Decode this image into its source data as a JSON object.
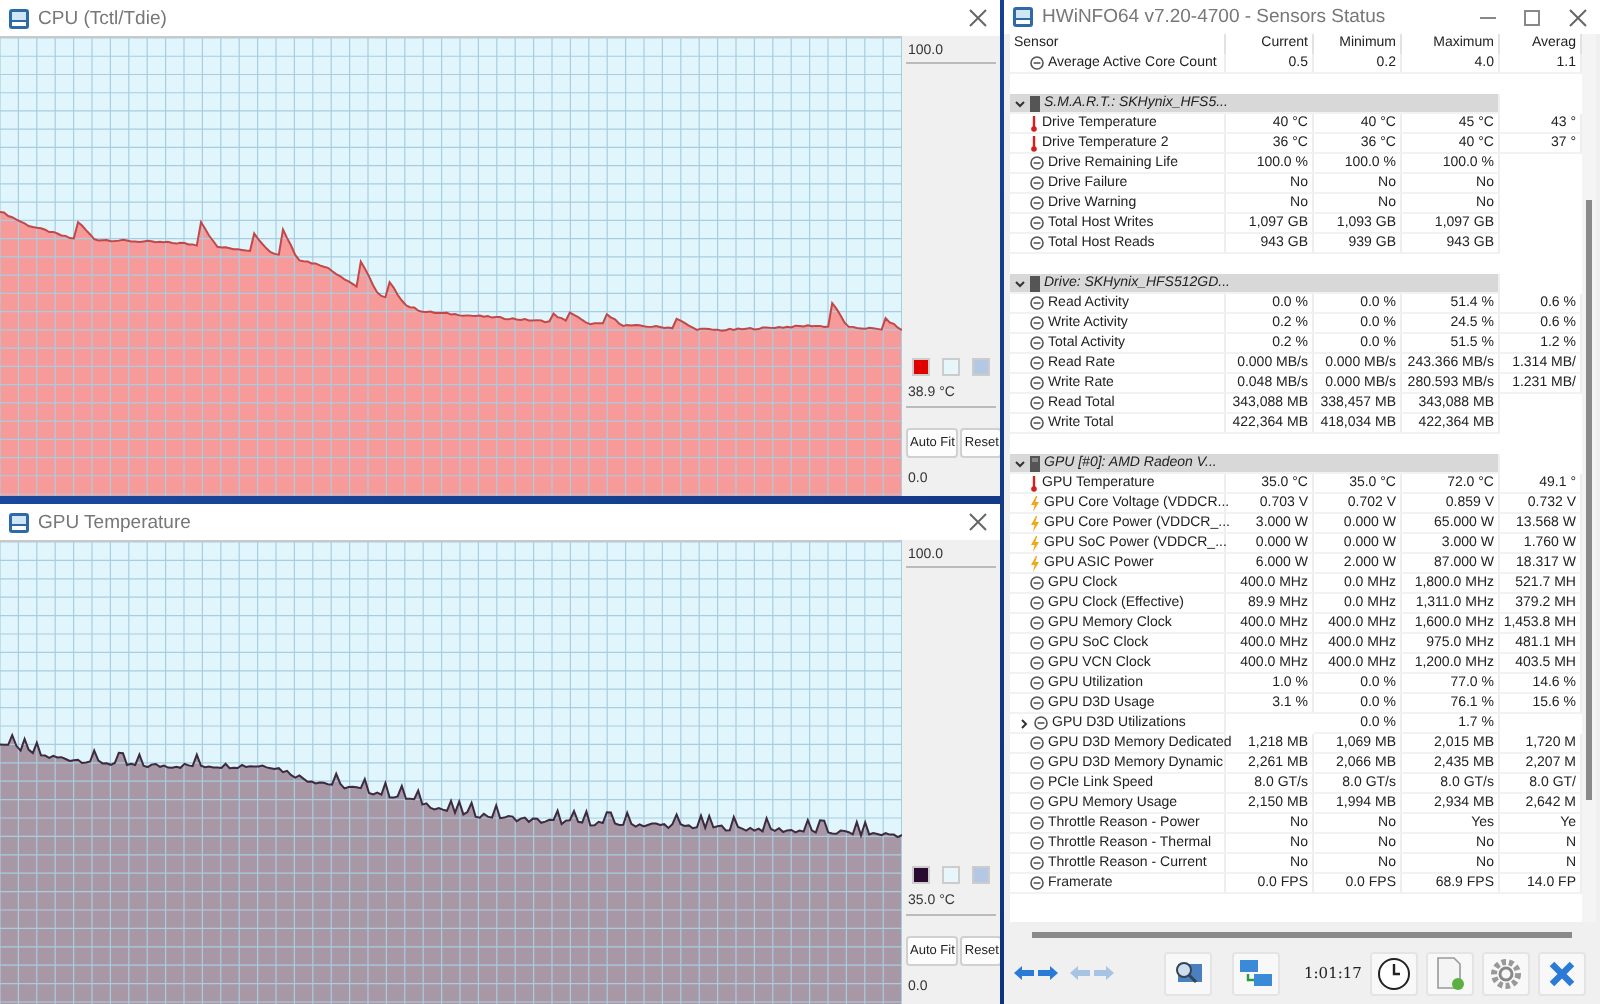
{
  "graph_windows": [
    {
      "title": "CPU (Tctl/Tdie)",
      "scale_max": "100.0",
      "scale_min": "0.0",
      "reading": "38.9 °C",
      "swatches": [
        {
          "color": "#e00000"
        },
        {
          "color": "#e6f6fb"
        },
        {
          "color": "#b4c8e4"
        }
      ],
      "buttons": [
        "Auto Fit",
        "Reset"
      ]
    },
    {
      "title": "GPU Temperature",
      "scale_max": "100.0",
      "scale_min": "0.0",
      "reading": "35.0 °C",
      "swatches": [
        {
          "color": "#2a0a30"
        },
        {
          "color": "#e6f6fb"
        },
        {
          "color": "#b4c8e4"
        }
      ],
      "buttons": [
        "Auto Fit",
        "Reset"
      ]
    }
  ],
  "sensors_window": {
    "title": "HWiNFO64 v7.20-4700 - Sensors Status",
    "columns": [
      "Sensor",
      "Current",
      "Minimum",
      "Maximum",
      "Averag"
    ],
    "top_rows": [
      {
        "kind": "gauge",
        "name": "Average Active Core Count",
        "current": "0.5",
        "minimum": "0.2",
        "maximum": "4.0",
        "average": "1.1"
      }
    ],
    "groups": [
      {
        "title": "S.M.A.R.T.: SKHynix_HFS5...",
        "kind": "drive",
        "expanded": true,
        "rows": [
          {
            "kind": "temperature",
            "name": "Drive Temperature",
            "current": "40 °C",
            "minimum": "40 °C",
            "maximum": "45 °C",
            "average": "43 °"
          },
          {
            "kind": "temperature",
            "name": "Drive Temperature 2",
            "current": "36 °C",
            "minimum": "36 °C",
            "maximum": "40 °C",
            "average": "37 °"
          },
          {
            "kind": "gauge",
            "name": "Drive Remaining Life",
            "current": "100.0 %",
            "minimum": "100.0 %",
            "maximum": "100.0 %"
          },
          {
            "kind": "gauge",
            "name": "Drive Failure",
            "current": "No",
            "minimum": "No",
            "maximum": "No"
          },
          {
            "kind": "gauge",
            "name": "Drive Warning",
            "current": "No",
            "minimum": "No",
            "maximum": "No"
          },
          {
            "kind": "gauge",
            "name": "Total Host Writes",
            "current": "1,097 GB",
            "minimum": "1,093 GB",
            "maximum": "1,097 GB"
          },
          {
            "kind": "gauge",
            "name": "Total Host Reads",
            "current": "943 GB",
            "minimum": "939 GB",
            "maximum": "943 GB"
          }
        ]
      },
      {
        "title": "Drive: SKHynix_HFS512GD...",
        "kind": "drive",
        "expanded": true,
        "rows": [
          {
            "kind": "gauge",
            "name": "Read Activity",
            "current": "0.0 %",
            "minimum": "0.0 %",
            "maximum": "51.4 %",
            "average": "0.6 %"
          },
          {
            "kind": "gauge",
            "name": "Write Activity",
            "current": "0.2 %",
            "minimum": "0.0 %",
            "maximum": "24.5 %",
            "average": "0.6 %"
          },
          {
            "kind": "gauge",
            "name": "Total Activity",
            "current": "0.2 %",
            "minimum": "0.0 %",
            "maximum": "51.5 %",
            "average": "1.2 %"
          },
          {
            "kind": "gauge",
            "name": "Read Rate",
            "current": "0.000 MB/s",
            "minimum": "0.000 MB/s",
            "maximum": "243.366 MB/s",
            "average": "1.314 MB/"
          },
          {
            "kind": "gauge",
            "name": "Write Rate",
            "current": "0.048 MB/s",
            "minimum": "0.000 MB/s",
            "maximum": "280.593 MB/s",
            "average": "1.231 MB/"
          },
          {
            "kind": "gauge",
            "name": "Read Total",
            "current": "343,088 MB",
            "minimum": "338,457 MB",
            "maximum": "343,088 MB"
          },
          {
            "kind": "gauge",
            "name": "Write Total",
            "current": "422,364 MB",
            "minimum": "418,034 MB",
            "maximum": "422,364 MB"
          }
        ]
      },
      {
        "title": "GPU [#0]: AMD Radeon V...",
        "kind": "card",
        "expanded": true,
        "rows": [
          {
            "kind": "temperature",
            "name": "GPU Temperature",
            "current": "35.0 °C",
            "minimum": "35.0 °C",
            "maximum": "72.0 °C",
            "average": "49.1 °"
          },
          {
            "kind": "power",
            "name": "GPU Core Voltage (VDDCR...",
            "current": "0.703 V",
            "minimum": "0.702 V",
            "maximum": "0.859 V",
            "average": "0.732 V"
          },
          {
            "kind": "power",
            "name": "GPU Core Power (VDDCR_...",
            "current": "3.000 W",
            "minimum": "0.000 W",
            "maximum": "65.000 W",
            "average": "13.568 W"
          },
          {
            "kind": "power",
            "name": "GPU SoC Power (VDDCR_...",
            "current": "0.000 W",
            "minimum": "0.000 W",
            "maximum": "3.000 W",
            "average": "1.760 W"
          },
          {
            "kind": "power",
            "name": "GPU ASIC Power",
            "current": "6.000 W",
            "minimum": "2.000 W",
            "maximum": "87.000 W",
            "average": "18.317 W"
          },
          {
            "kind": "gauge",
            "name": "GPU Clock",
            "current": "400.0 MHz",
            "minimum": "0.0 MHz",
            "maximum": "1,800.0 MHz",
            "average": "521.7 MH"
          },
          {
            "kind": "gauge",
            "name": "GPU Clock (Effective)",
            "current": "89.9 MHz",
            "minimum": "0.0 MHz",
            "maximum": "1,311.0 MHz",
            "average": "379.2 MH"
          },
          {
            "kind": "gauge",
            "name": "GPU Memory Clock",
            "current": "400.0 MHz",
            "minimum": "400.0 MHz",
            "maximum": "1,600.0 MHz",
            "average": "1,453.8 MH"
          },
          {
            "kind": "gauge",
            "name": "GPU SoC Clock",
            "current": "400.0 MHz",
            "minimum": "400.0 MHz",
            "maximum": "975.0 MHz",
            "average": "481.1 MH"
          },
          {
            "kind": "gauge",
            "name": "GPU VCN Clock",
            "current": "400.0 MHz",
            "minimum": "400.0 MHz",
            "maximum": "1,200.0 MHz",
            "average": "403.5 MH"
          },
          {
            "kind": "gauge",
            "name": "GPU Utilization",
            "current": "1.0 %",
            "minimum": "0.0 %",
            "maximum": "77.0 %",
            "average": "14.6 %"
          },
          {
            "kind": "gauge",
            "name": "GPU D3D Usage",
            "current": "3.1 %",
            "minimum": "0.0 %",
            "maximum": "76.1 %",
            "average": "15.6 %"
          },
          {
            "kind": "gauge",
            "name": "GPU D3D Utilizations",
            "expanded": false,
            "minimum": "0.0 %",
            "maximum": "1.7 %"
          },
          {
            "kind": "gauge",
            "name": "GPU D3D Memory Dedicated",
            "current": "1,218 MB",
            "minimum": "1,069 MB",
            "maximum": "2,015 MB",
            "average": "1,720 M"
          },
          {
            "kind": "gauge",
            "name": "GPU D3D Memory Dynamic",
            "current": "2,261 MB",
            "minimum": "2,066 MB",
            "maximum": "2,435 MB",
            "average": "2,207 M"
          },
          {
            "kind": "gauge",
            "name": "PCIe Link Speed",
            "current": "8.0 GT/s",
            "minimum": "8.0 GT/s",
            "maximum": "8.0 GT/s",
            "average": "8.0 GT/"
          },
          {
            "kind": "gauge",
            "name": "GPU Memory Usage",
            "current": "2,150 MB",
            "minimum": "1,994 MB",
            "maximum": "2,934 MB",
            "average": "2,642 M"
          },
          {
            "kind": "gauge",
            "name": "Throttle Reason - Power",
            "current": "No",
            "minimum": "No",
            "maximum": "Yes",
            "average": "Ye"
          },
          {
            "kind": "gauge",
            "name": "Throttle Reason - Thermal",
            "current": "No",
            "minimum": "No",
            "maximum": "No",
            "average": "N"
          },
          {
            "kind": "gauge",
            "name": "Throttle Reason - Current",
            "current": "No",
            "minimum": "No",
            "maximum": "No",
            "average": "N"
          },
          {
            "kind": "gauge",
            "name": "Framerate",
            "current": "0.0 FPS",
            "minimum": "0.0 FPS",
            "maximum": "68.9 FPS",
            "average": "14.0 FP"
          }
        ]
      }
    ],
    "elapsed": "1:01:17",
    "toolbar": [
      {
        "kind": "arrows",
        "disabled": false
      },
      {
        "kind": "arrows",
        "disabled": true
      },
      {
        "kind": "search"
      },
      {
        "kind": "network"
      },
      {
        "kind": "time"
      },
      {
        "kind": "clock"
      },
      {
        "kind": "report"
      },
      {
        "kind": "settings"
      },
      {
        "kind": "close"
      }
    ]
  }
}
